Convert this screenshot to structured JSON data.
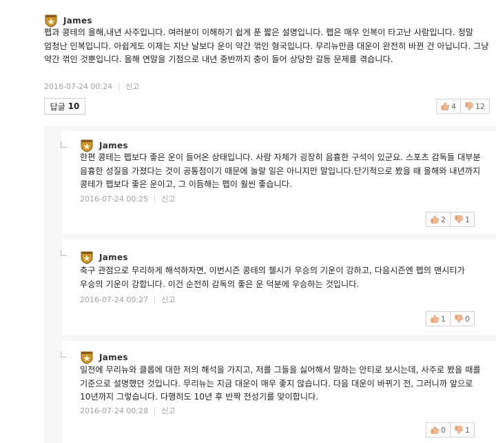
{
  "main_comment": {
    "author": "James",
    "text": "펩과 콩테의 올해,내년 사주입니다. 여러분이 이해하기 쉽게 푼 짧은 설명입니다. 펩은 매우 인복이 타고난 사람입니다. 정말 엄청난 인복입니다. 아쉽게도 이제는 지난 날보다 운이 약간 꺾인 형국입니다. 무리뉴만큼 대운이 완전히 바뀐 건 아닙니다. 그냥 약간 꺾인 것뿐입니다. 올해 연말을 기점으로 내년 중반까지 충이 들어 상당한 갈등 문제를 겪습니다.",
    "timestamp": "2016-07-24 00:24",
    "report_label": "신고",
    "reply_label": "답글",
    "reply_count": "10",
    "likes": "4",
    "dislikes": "12"
  },
  "replies": [
    {
      "author": "James",
      "text": "한편 콩테는 펩보다 좋은 운이 들어온 상태입니다. 사람 자체가 굉장히 음흉한 구석이 있군요. 스포츠 감독들 대부분 음흉한 성질을 가졌다는 것이 공통점이기 때문에 놀랄 일은 아니지만 말입니다.단기적으로 봤을 때 올해와 내년까지 콩테가 펩보다 좋은 운이고, 그 이듬해는 펩이 훨씬 좋습니다.",
      "timestamp": "2016-07-24 00:25",
      "report_label": "신고",
      "likes": "2",
      "dislikes": "1"
    },
    {
      "author": "James",
      "text": "축구 관점으로 무리하게 해석하자면, 이번시즌 콩테의 첼시가 우승의 기운이 강하고, 다음시즌엔 펩의 맨시티가 우승의 기운이 강합니다. 이건 순전히 감독의 좋은 운 덕분에 우승하는 것입니다.",
      "timestamp": "2016-07-24 00:27",
      "report_label": "신고",
      "likes": "1",
      "dislikes": "0"
    },
    {
      "author": "James",
      "text": "일전에 무리뉴와 클롭에 대한 저의 해석을 가지고, 저를 그들을 싫어해서 말하는 안티로 보시는데, 사주로 봤을 때를 기준으로 설명했던 것입니다. 무리뉴는 지금 대운이 매우 좋지 않습니다. 다음 대운이 바뀌기 전, 그러니까 앞으로 10년까지 그렇습니다. 다행히도 10년 후 반짝 전성기를 맞이합니다.",
      "timestamp": "2016-07-24 00:28",
      "report_label": "신고",
      "likes": "0",
      "dislikes": "1"
    }
  ],
  "colors": {
    "badge_gold": "#c9962c",
    "badge_dark": "#8a5a12",
    "reply_bg": "#f7f7f7",
    "meta_text": "#a0a0a0"
  },
  "icons": {
    "author_badge": "star-shield-icon",
    "like": "thumbs-up-icon",
    "dislike": "thumbs-down-icon",
    "reply_elbow": "reply-elbow-icon"
  }
}
